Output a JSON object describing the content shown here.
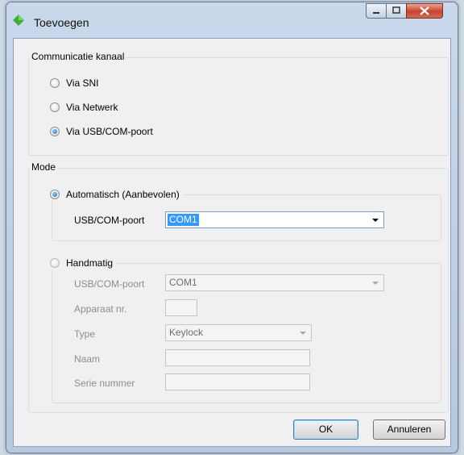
{
  "window": {
    "title": "Toevoegen"
  },
  "window_controls": {
    "minimize": "minimize",
    "maximize": "maximize",
    "close": "close"
  },
  "channel_group": {
    "title": "Communicatie kanaal",
    "options": [
      {
        "label": "Via SNI",
        "selected": false
      },
      {
        "label": "Via Netwerk",
        "selected": false
      },
      {
        "label": "Via USB/COM-poort",
        "selected": true
      }
    ]
  },
  "mode_group": {
    "title": "Mode",
    "auto": {
      "label": "Automatisch (Aanbevolen)",
      "selected": true,
      "port_label": "USB/COM-poort",
      "port_value": "COM1"
    },
    "manual": {
      "label": "Handmatig",
      "selected": false,
      "port_label": "USB/COM-poort",
      "port_value": "COM1",
      "device_label": "Apparaat nr.",
      "device_value": "",
      "type_label": "Type",
      "type_value": "Keylock",
      "name_label": "Naam",
      "name_value": "",
      "serial_label": "Serie nummer",
      "serial_value": ""
    }
  },
  "buttons": {
    "ok": "OK",
    "cancel": "Annuleren"
  }
}
